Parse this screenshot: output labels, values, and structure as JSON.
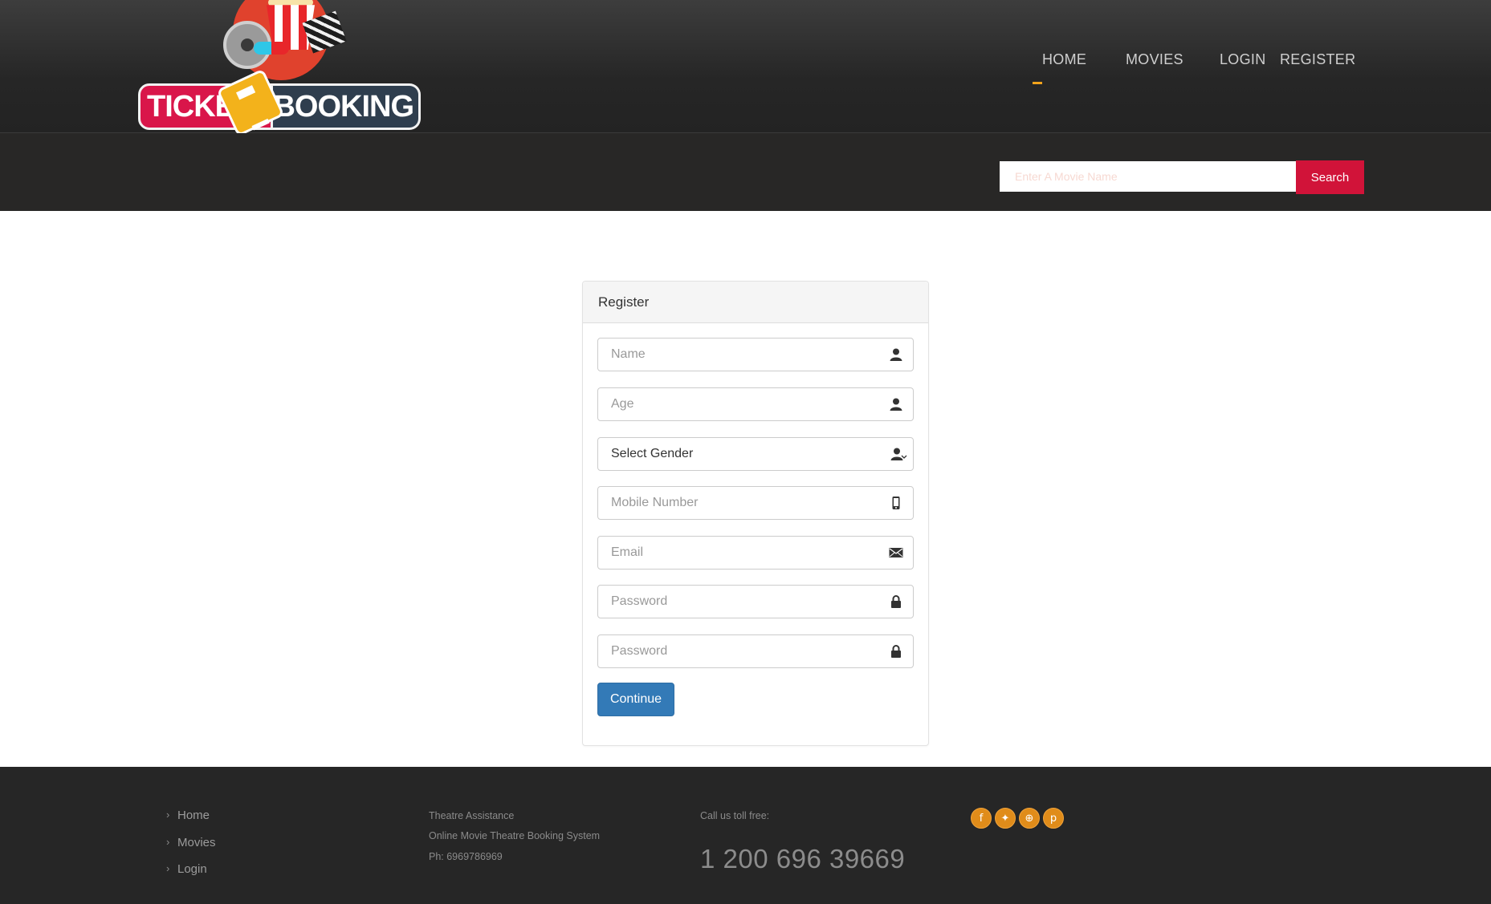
{
  "brand": {
    "logo_text_left": "TICKE",
    "logo_text_right": "BOOKING"
  },
  "nav": {
    "home": "HOME",
    "movies": "MOVIES",
    "login": "LOGIN",
    "register": "REGISTER",
    "active": "HOME"
  },
  "search": {
    "placeholder": "Enter A Movie Name",
    "button": "Search"
  },
  "register_panel": {
    "title": "Register",
    "name_placeholder": "Name",
    "age_placeholder": "Age",
    "gender_value": "Select Gender",
    "mobile_placeholder": "Mobile Number",
    "email_placeholder": "Email",
    "password_placeholder": "Password",
    "confirm_password_placeholder": "Password",
    "continue_label": "Continue"
  },
  "footer": {
    "links": [
      "Home",
      "Movies",
      "Login"
    ],
    "info": [
      "Theatre Assistance",
      "Online Movie Theatre Booking System",
      "Ph: 6969786969"
    ],
    "call_label": "Call us toll free:",
    "phone": "1 200 696 39669",
    "social_icons": [
      "facebook-icon",
      "twitter-icon",
      "dribbble-icon",
      "pinterest-icon"
    ]
  },
  "colors": {
    "accent_orange": "#f2a31b",
    "search_red": "#d11339",
    "primary_blue": "#337ab7",
    "header_dark": "#282726"
  }
}
